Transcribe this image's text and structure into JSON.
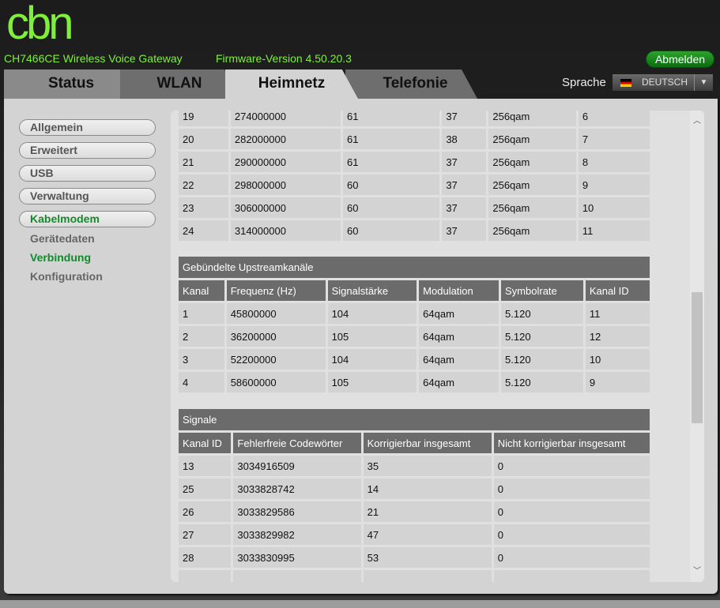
{
  "header": {
    "logo": "cbn",
    "model": "CH7466CE  Wireless Voice Gateway",
    "firmware": "Firmware-Version  4.50.20.3",
    "logout": "Abmelden",
    "language_label": "Sprache",
    "language": "DEUTSCH"
  },
  "tabs": [
    "Status",
    "WLAN",
    "Heimnetz",
    "Telefonie"
  ],
  "sidebar": {
    "buttons": [
      "Allgemein",
      "Erweitert",
      "USB",
      "Verwaltung",
      "Kabelmodem"
    ],
    "sub": [
      "Gerätedaten",
      "Verbindung",
      "Konfiguration"
    ]
  },
  "downstream": {
    "rows": [
      [
        "19",
        "274000000",
        "61",
        "37",
        "256qam",
        "6"
      ],
      [
        "20",
        "282000000",
        "61",
        "38",
        "256qam",
        "7"
      ],
      [
        "21",
        "290000000",
        "61",
        "37",
        "256qam",
        "8"
      ],
      [
        "22",
        "298000000",
        "60",
        "37",
        "256qam",
        "9"
      ],
      [
        "23",
        "306000000",
        "60",
        "37",
        "256qam",
        "10"
      ],
      [
        "24",
        "314000000",
        "60",
        "37",
        "256qam",
        "11"
      ]
    ]
  },
  "upstream": {
    "title": "Gebündelte Upstreamkanäle",
    "headers": [
      "Kanal",
      "Frequenz (Hz)",
      "Signalstärke",
      "Modulation",
      "Symbolrate",
      "Kanal ID"
    ],
    "rows": [
      [
        "1",
        "45800000",
        "104",
        "64qam",
        "5.120",
        "11"
      ],
      [
        "2",
        "36200000",
        "105",
        "64qam",
        "5.120",
        "12"
      ],
      [
        "3",
        "52200000",
        "104",
        "64qam",
        "5.120",
        "10"
      ],
      [
        "4",
        "58600000",
        "105",
        "64qam",
        "5.120",
        "9"
      ]
    ]
  },
  "signale": {
    "title": "Signale",
    "headers": [
      "Kanal ID",
      "Fehlerfreie Codewörter",
      "Korrigierbar insgesamt",
      "Nicht korrigierbar insgesamt"
    ],
    "rows": [
      [
        "13",
        "3034916509",
        "35",
        "0"
      ],
      [
        "25",
        "3033828742",
        "14",
        "0"
      ],
      [
        "26",
        "3033829586",
        "21",
        "0"
      ],
      [
        "27",
        "3033829982",
        "47",
        "0"
      ],
      [
        "28",
        "3033830995",
        "53",
        "0"
      ],
      [
        "",
        "",
        "",
        ""
      ]
    ]
  }
}
